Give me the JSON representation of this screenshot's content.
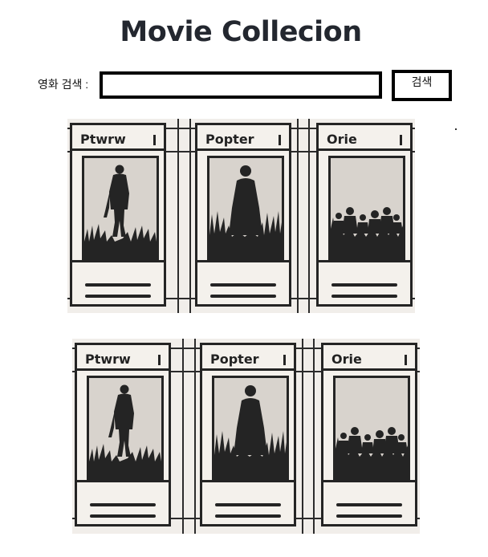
{
  "page": {
    "title": "Movie Collecion"
  },
  "search": {
    "label": "영화 검색 :",
    "input_value": "",
    "button_label": "검색"
  },
  "movie_rows": [
    {
      "cards": [
        {
          "title": "Ptwrw",
          "poster_icon": "lone-figure-in-grass-icon"
        },
        {
          "title": "Popter",
          "poster_icon": "hooded-figure-in-grass-icon"
        },
        {
          "title": "Orie",
          "poster_icon": "crowd-in-grass-icon"
        }
      ]
    },
    {
      "cards": [
        {
          "title": "Ptwrw",
          "poster_icon": "lone-figure-in-grass-icon"
        },
        {
          "title": "Popter",
          "poster_icon": "hooded-figure-in-grass-icon"
        },
        {
          "title": "Orie",
          "poster_icon": "crowd-in-grass-icon"
        }
      ]
    }
  ],
  "colors": {
    "title_text": "#23272f",
    "ink": "#242424",
    "poster_background": "#d8d3cd",
    "strip_background": "#f1eeea"
  }
}
